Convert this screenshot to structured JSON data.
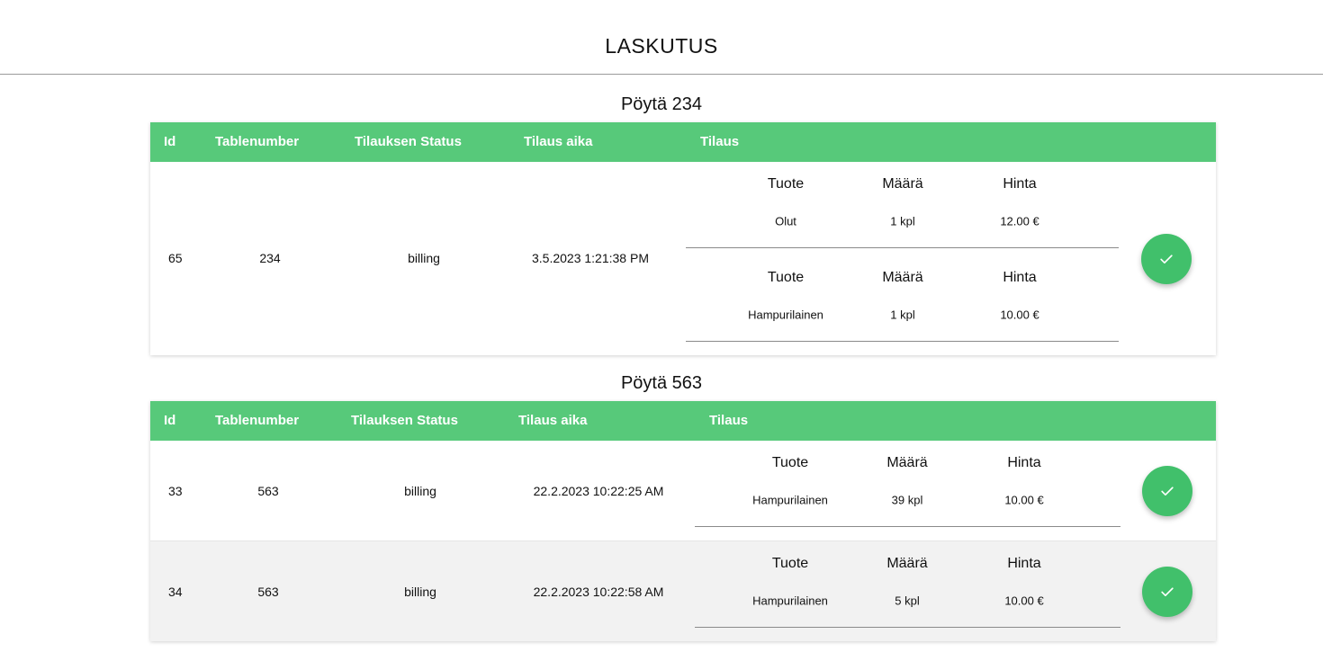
{
  "page": {
    "title": "LASKUTUS"
  },
  "colors": {
    "header_green": "#57c97a",
    "button_green": "#41c06b"
  },
  "tables": [
    {
      "title": "Pöytä 234",
      "headers": {
        "id": "Id",
        "tablenumber": "Tablenumber",
        "status": "Tilauksen Status",
        "time": "Tilaus aika",
        "order": "Tilaus"
      },
      "orders": [
        {
          "id": "65",
          "tablenumber": "234",
          "status": "billing",
          "time": "3.5.2023 1:21:38 PM",
          "items": [
            {
              "product_label": "Tuote",
              "quantity_label": "Määrä",
              "price_label": "Hinta",
              "product": "Olut",
              "quantity": "1 kpl",
              "price": "12.00 €"
            },
            {
              "product_label": "Tuote",
              "quantity_label": "Määrä",
              "price_label": "Hinta",
              "product": "Hampurilainen",
              "quantity": "1 kpl",
              "price": "10.00 €"
            }
          ],
          "action_icon": "check-icon"
        }
      ]
    },
    {
      "title": "Pöytä 563",
      "headers": {
        "id": "Id",
        "tablenumber": "Tablenumber",
        "status": "Tilauksen Status",
        "time": "Tilaus aika",
        "order": "Tilaus"
      },
      "orders": [
        {
          "id": "33",
          "tablenumber": "563",
          "status": "billing",
          "time": "22.2.2023 10:22:25 AM",
          "items": [
            {
              "product_label": "Tuote",
              "quantity_label": "Määrä",
              "price_label": "Hinta",
              "product": "Hampurilainen",
              "quantity": "39 kpl",
              "price": "10.00 €"
            }
          ],
          "action_icon": "check-icon"
        },
        {
          "id": "34",
          "tablenumber": "563",
          "status": "billing",
          "time": "22.2.2023 10:22:58 AM",
          "items": [
            {
              "product_label": "Tuote",
              "quantity_label": "Määrä",
              "price_label": "Hinta",
              "product": "Hampurilainen",
              "quantity": "5 kpl",
              "price": "10.00 €"
            }
          ],
          "action_icon": "check-icon"
        }
      ]
    }
  ]
}
